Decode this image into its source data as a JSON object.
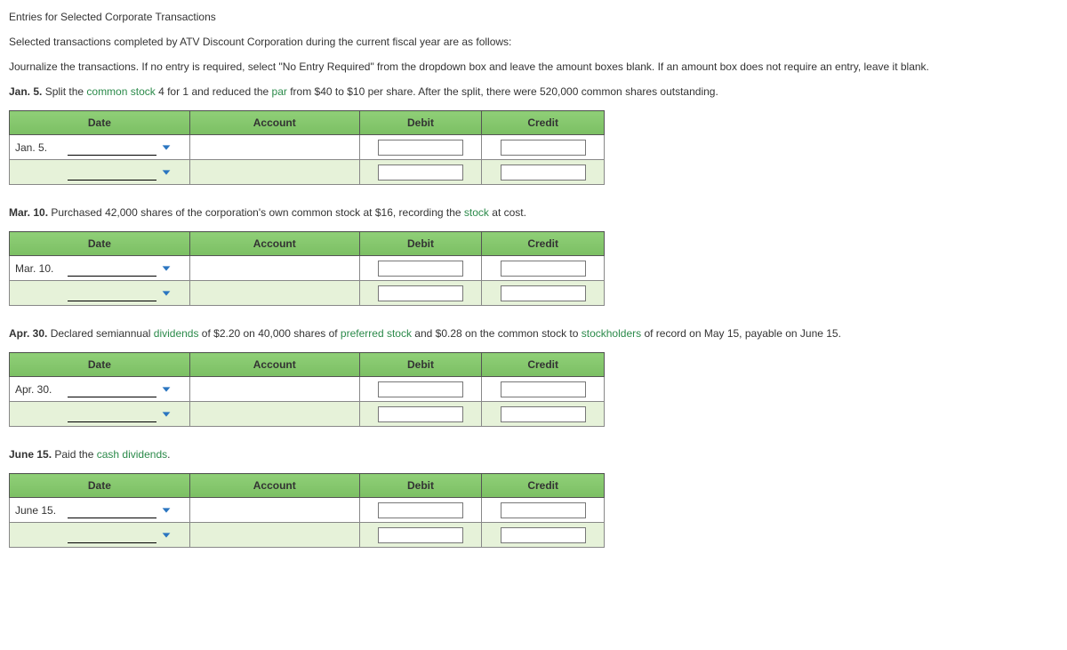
{
  "heading": "Entries for Selected Corporate Transactions",
  "intro": "Selected transactions completed by ATV Discount Corporation during the current fiscal year are as follows:",
  "instructions": "Journalize the transactions. If no entry is required, select \"No Entry Required\" from the dropdown box and leave the amount boxes blank. If an amount box does not require an entry, leave it blank.",
  "headers": {
    "date": "Date",
    "account": "Account",
    "debit": "Debit",
    "credit": "Credit"
  },
  "entries": [
    {
      "prompt_prefix": "Jan. 5.",
      "prompt_segments": [
        {
          "t": " Split the "
        },
        {
          "t": "common stock",
          "link": true
        },
        {
          "t": " 4 for 1 and reduced the "
        },
        {
          "t": "par",
          "link": true
        },
        {
          "t": " from $40 to $10 per share. After the split, there were 520,000 common shares outstanding."
        }
      ],
      "date_label": "Jan. 5."
    },
    {
      "prompt_prefix": "Mar. 10.",
      "prompt_segments": [
        {
          "t": " Purchased 42,000 shares of the corporation's own common stock at $16, recording the "
        },
        {
          "t": "stock",
          "link": true
        },
        {
          "t": " at cost."
        }
      ],
      "date_label": "Mar. 10."
    },
    {
      "prompt_prefix": "Apr. 30.",
      "prompt_segments": [
        {
          "t": " Declared semiannual "
        },
        {
          "t": "dividends",
          "link": true
        },
        {
          "t": " of $2.20 on 40,000 shares of "
        },
        {
          "t": "preferred stock",
          "link": true
        },
        {
          "t": " and $0.28 on the common stock to "
        },
        {
          "t": "stockholders",
          "link": true
        },
        {
          "t": " of record on May 15, payable on June 15."
        }
      ],
      "date_label": "Apr. 30."
    },
    {
      "prompt_prefix": "June 15.",
      "prompt_segments": [
        {
          "t": " Paid the "
        },
        {
          "t": "cash dividends",
          "link": true
        },
        {
          "t": "."
        }
      ],
      "date_label": "June 15."
    }
  ]
}
